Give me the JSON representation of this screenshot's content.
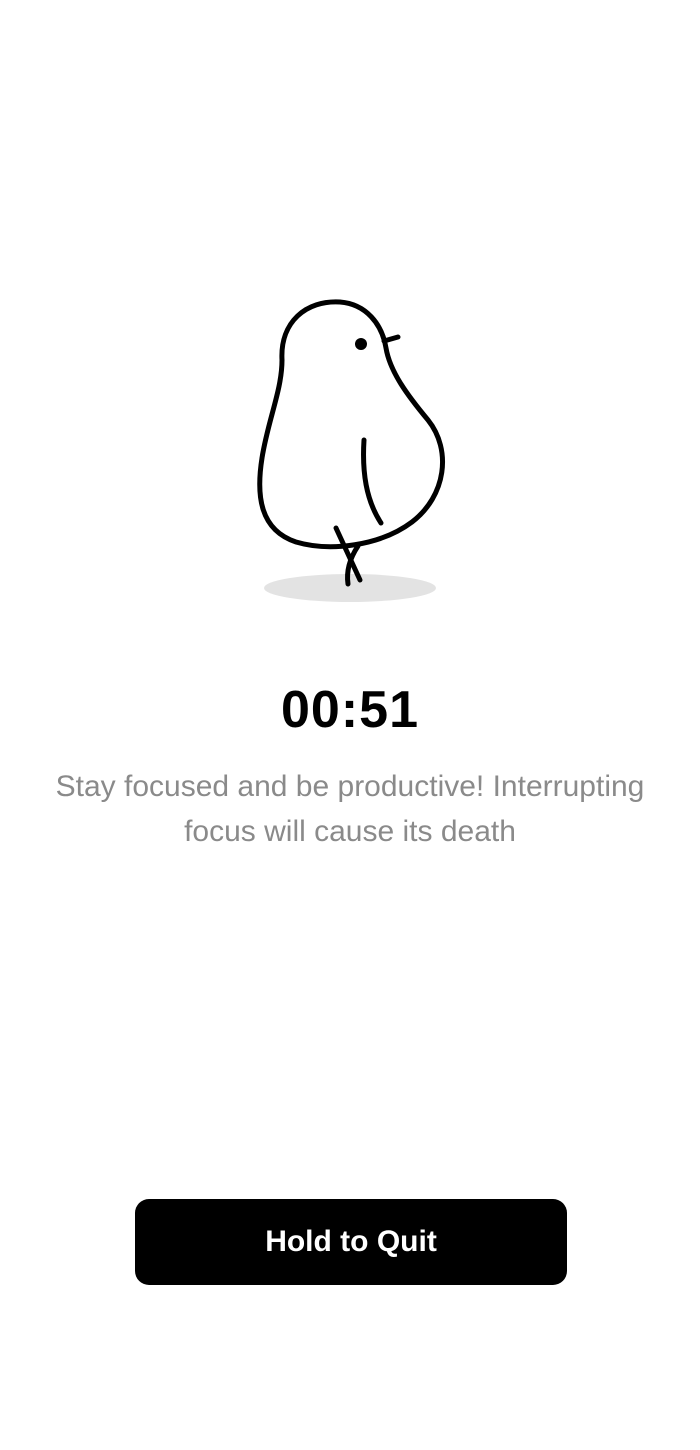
{
  "focus_screen": {
    "illustration": "chick-icon",
    "timer": "00:51",
    "message": "Stay focused and be productive! Interrupting focus will cause its death",
    "quit_button_label": "Hold to Quit"
  },
  "colors": {
    "background": "#ffffff",
    "primary": "#000000",
    "message_text": "#8a8a8a",
    "shadow": "#e3e3e3",
    "button_text": "#ffffff"
  }
}
